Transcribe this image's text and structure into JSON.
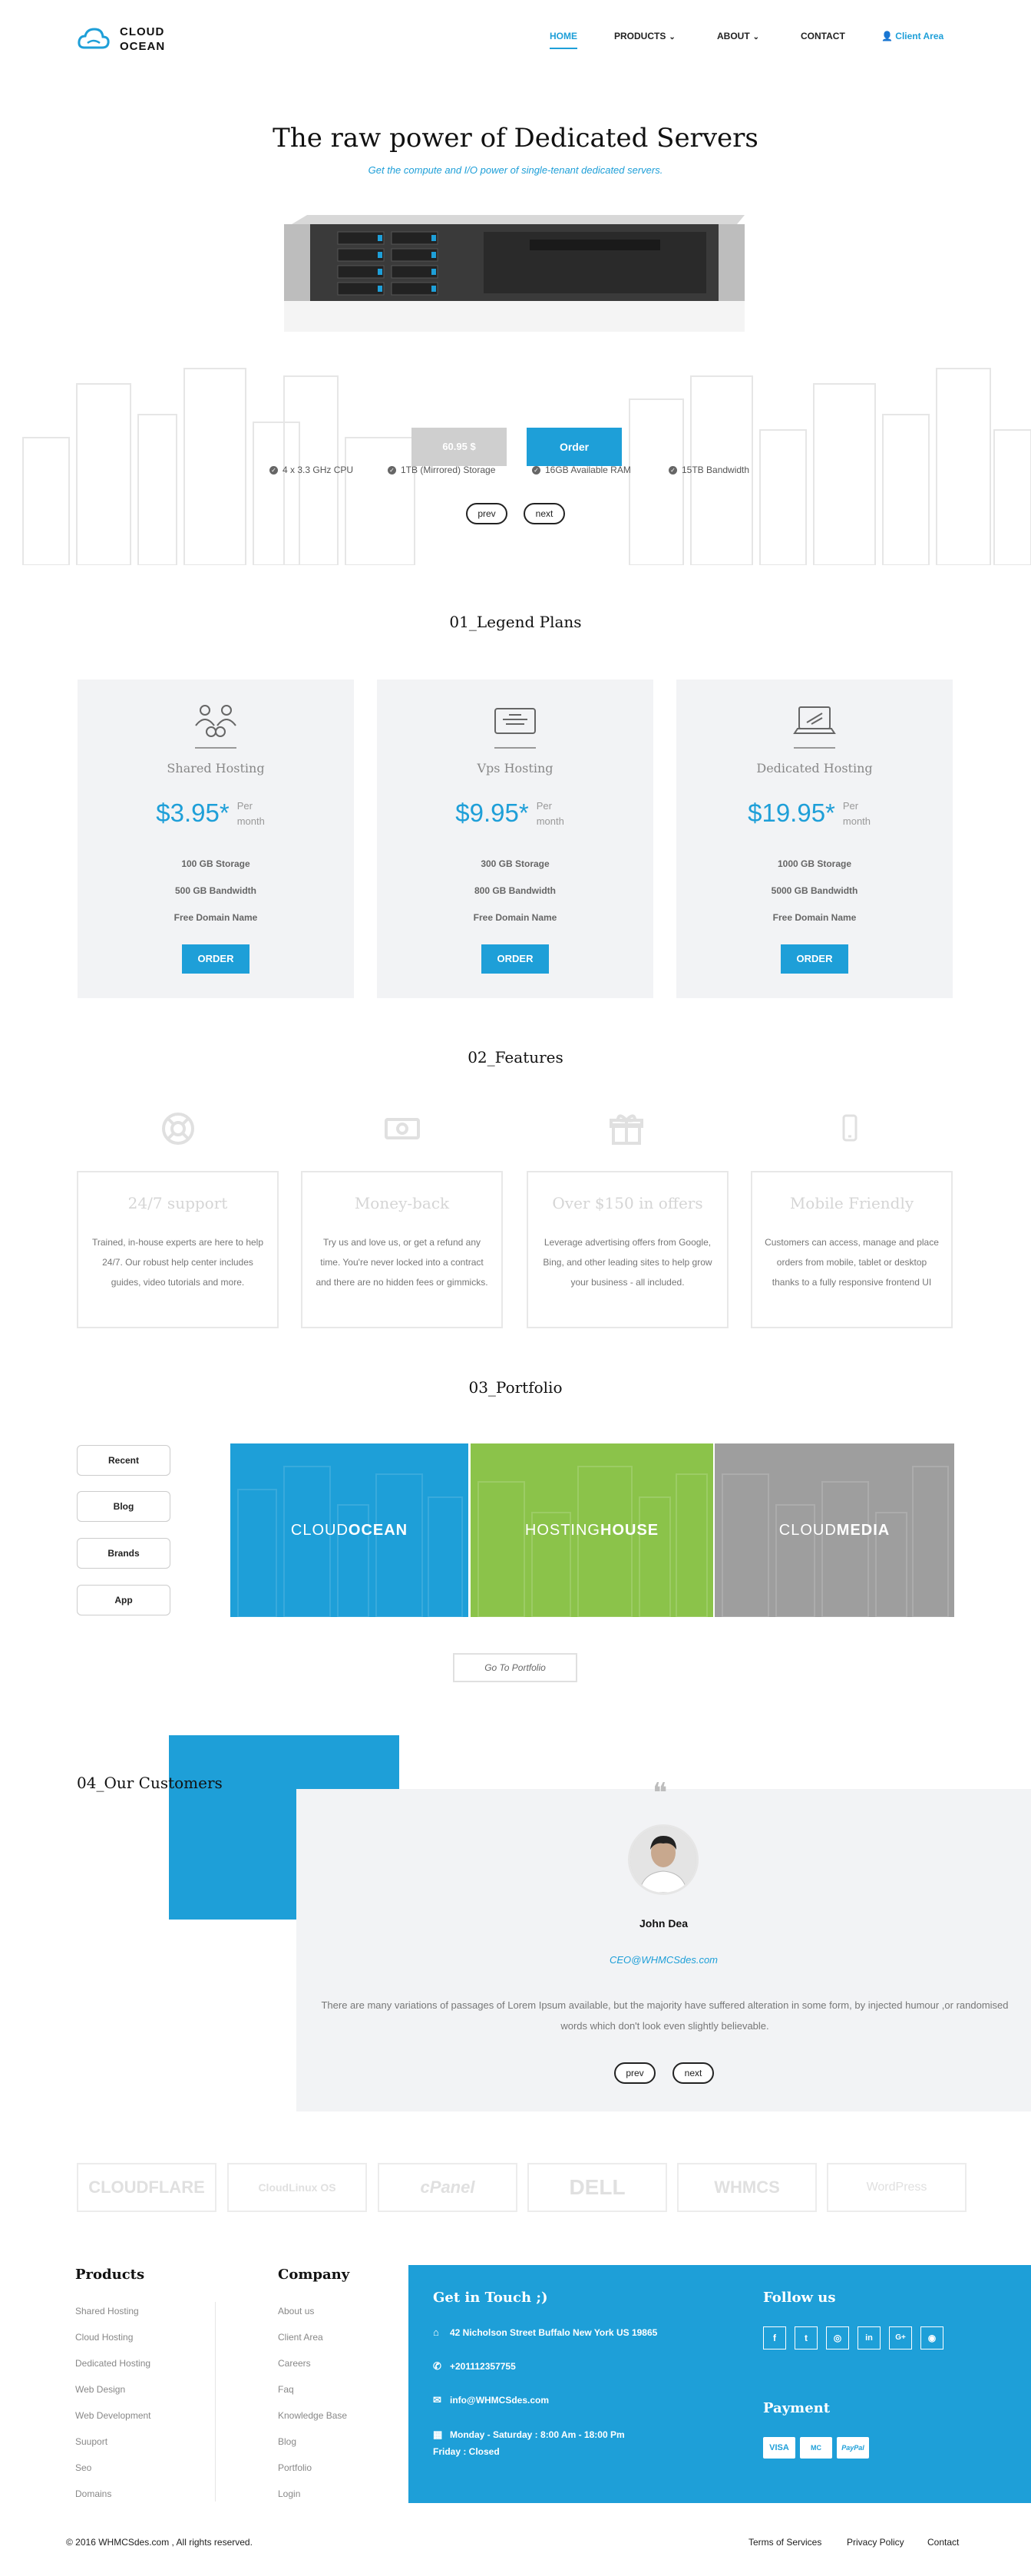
{
  "brand": {
    "line1": "CLOUD",
    "line2": "OCEAN"
  },
  "nav": {
    "home": "HOME",
    "products": "PRODUCTS",
    "about": "ABOUT",
    "contact": "CONTACT",
    "client_area": "Client Area"
  },
  "hero": {
    "title": "The raw power of Dedicated Servers",
    "subtitle": "Get the compute and I/O power of single-tenant dedicated servers.",
    "specs": [
      "4 x 3.3 GHz CPU",
      "1TB (Mirrored) Storage",
      "16GB Available RAM",
      "15TB Bandwidth"
    ],
    "price_button": "60.95 $",
    "order_button": "Order",
    "prev": "prev",
    "next": "next"
  },
  "plans": {
    "title": "01_Legend Plans",
    "items": [
      {
        "name": "Shared Hosting",
        "price": "$3.95*",
        "per": "Per month",
        "features": [
          "100 GB Storage",
          "500 GB Bandwidth",
          "Free Domain Name"
        ],
        "button": "ORDER"
      },
      {
        "name": "Vps Hosting",
        "price": "$9.95*",
        "per": "Per month",
        "features": [
          "300 GB Storage",
          "800 GB Bandwidth",
          "Free Domain Name"
        ],
        "button": "ORDER"
      },
      {
        "name": "Dedicated Hosting",
        "price": "$19.95*",
        "per": "Per month",
        "features": [
          "1000 GB Storage",
          "5000 GB Bandwidth",
          "Free Domain Name"
        ],
        "button": "ORDER"
      }
    ]
  },
  "features": {
    "title": "02_Features",
    "items": [
      {
        "title": "24/7 support",
        "icon": "lifebuoy-icon",
        "text": "Trained, in-house experts are here to help 24/7. Our robust help center includes guides, video tutorials and more."
      },
      {
        "title": "Money-back",
        "icon": "money-icon",
        "text": "Try us and love us, or get a refund any time. You're never locked into a contract and there are no hidden fees or gimmicks."
      },
      {
        "title": "Over $150 in offers",
        "icon": "gift-icon",
        "text": "Leverage advertising offers from Google, Bing, and other leading sites to help grow your business - all included."
      },
      {
        "title": "Mobile Friendly",
        "icon": "mobile-icon",
        "text": "Customers can access, manage and place orders from mobile, tablet or desktop thanks to a fully responsive frontend UI"
      }
    ]
  },
  "portfolio": {
    "title": "03_Portfolio",
    "filters": [
      "Recent",
      "Blog",
      "Brands",
      "App"
    ],
    "tiles": [
      {
        "light": "CLOUD",
        "bold": "OCEAN",
        "color": "#1e9fd8"
      },
      {
        "light": "HOSTING",
        "bold": "HOUSE",
        "color": "#8bc34a"
      },
      {
        "light": "CLOUD",
        "bold": "MEDIA",
        "color": "#9e9e9e"
      }
    ],
    "button": "Go To Portfolio"
  },
  "customers": {
    "title": "04_Our Customers",
    "name": "John Dea",
    "role": "CEO@WHMCSdes.com",
    "text": "There are many variations of passages of Lorem Ipsum available, but the majority have suffered alteration in some form, by injected humour ,or randomised words which don't look even slightly believable.",
    "prev": "prev",
    "next": "next"
  },
  "partners": [
    "CLOUDFLARE",
    "CloudLinux OS",
    "cPanel",
    "DELL",
    "WHMCS",
    "WordPress"
  ],
  "footer": {
    "products": {
      "title": "Products",
      "links": [
        "Shared Hosting",
        "Cloud Hosting",
        "Dedicated Hosting",
        "Web Design",
        "Web Development",
        "Suuport",
        "Seo",
        "Domains"
      ]
    },
    "company": {
      "title": "Company",
      "links": [
        "About us",
        "Client Area",
        "Careers",
        "Faq",
        "Knowledge Base",
        "Blog",
        "Portfolio",
        "Login"
      ]
    },
    "contact": {
      "title": "Get in Touch ;)",
      "address": "42 Nicholson Street Buffalo New York US 19865",
      "phone": "+201112357755",
      "email": "info@WHMCSdes.com",
      "hours": "Monday - Saturday : 8:00 Am - 18:00 Pm",
      "closed": "Friday : Closed"
    },
    "follow": {
      "title": "Follow us",
      "icons": [
        "f",
        "t",
        "◎",
        "in",
        "G+",
        "◉"
      ]
    },
    "payment": {
      "title": "Payment",
      "methods": [
        "VISA",
        "MC",
        "PayPal"
      ]
    },
    "copyright": "© 2016 WHMCSdes.com , All rights reserved.",
    "bottom_links": [
      "Terms of Services",
      "Privacy Policy",
      "Contact"
    ]
  },
  "colors": {
    "accent": "#1e9fd8",
    "green": "#8bc34a",
    "gray": "#9e9e9e"
  }
}
